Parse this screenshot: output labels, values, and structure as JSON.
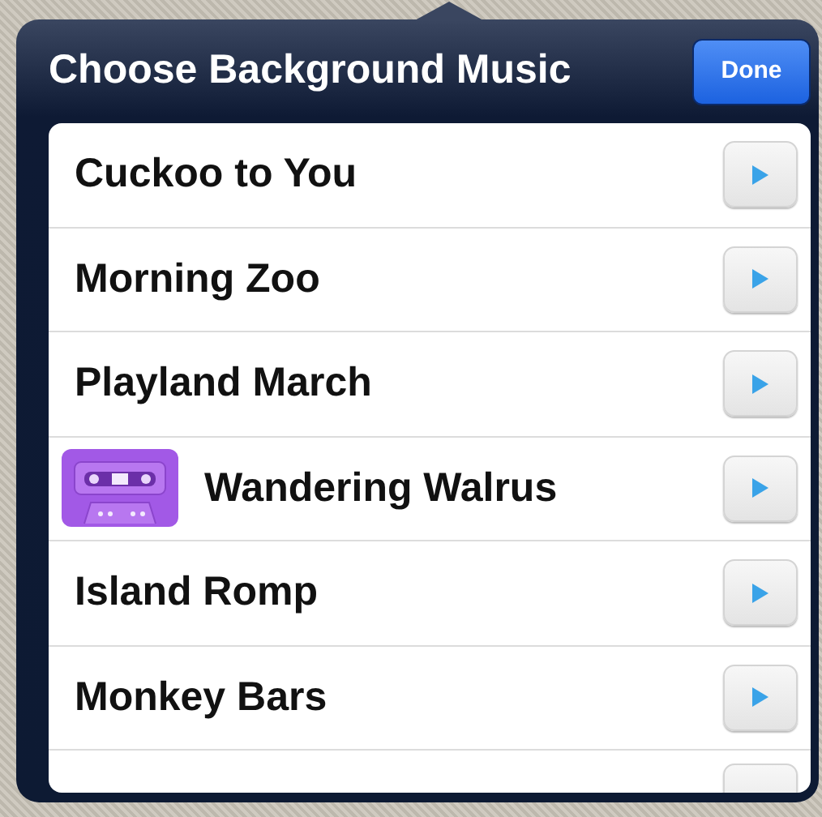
{
  "popover": {
    "title": "Choose Background Music",
    "done_button": "Done"
  },
  "tracks": [
    {
      "name": "Cuckoo to You",
      "selected": false
    },
    {
      "name": "Morning Zoo",
      "selected": false
    },
    {
      "name": "Playland March",
      "selected": false
    },
    {
      "name": "Wandering Walrus",
      "selected": true
    },
    {
      "name": "Island Romp",
      "selected": false
    },
    {
      "name": "Monkey Bars",
      "selected": false
    }
  ]
}
